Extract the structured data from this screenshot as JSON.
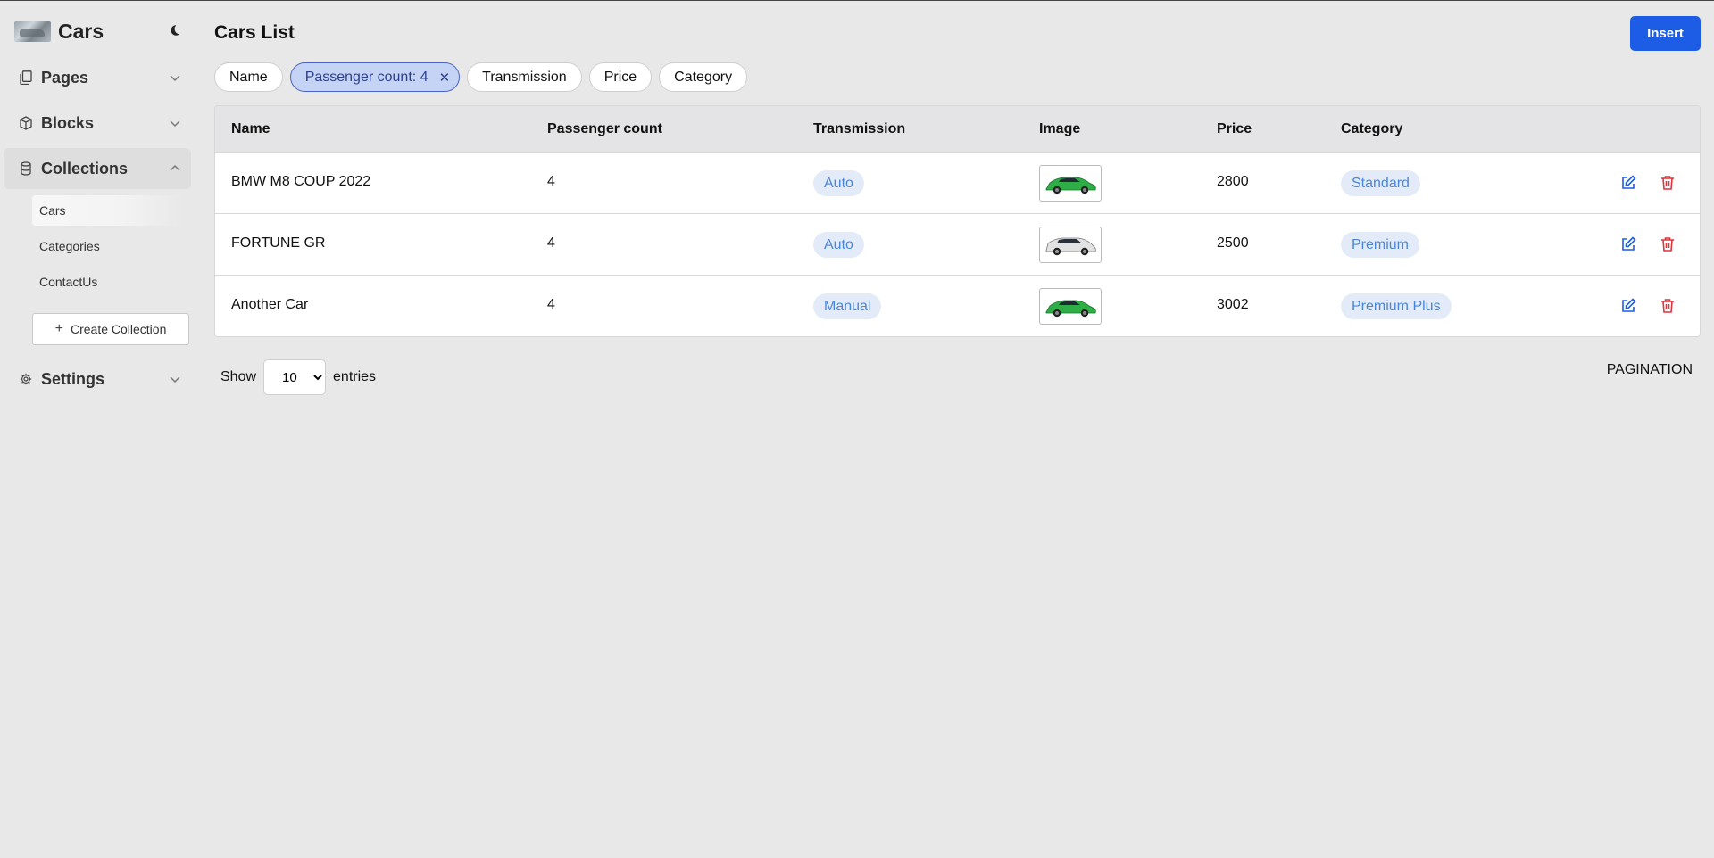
{
  "sidebar": {
    "brand_title": "Cars",
    "sections": [
      {
        "label": "Pages"
      },
      {
        "label": "Blocks"
      },
      {
        "label": "Collections"
      },
      {
        "label": "Settings"
      }
    ],
    "collection_items": [
      {
        "label": "Cars"
      },
      {
        "label": "Categories"
      },
      {
        "label": "ContactUs"
      }
    ],
    "create_collection_label": "Create Collection"
  },
  "header": {
    "title": "Cars List",
    "insert_label": "Insert"
  },
  "filters": [
    {
      "label": "Name"
    },
    {
      "label": "Passenger count: 4",
      "active": true
    },
    {
      "label": "Transmission"
    },
    {
      "label": "Price"
    },
    {
      "label": "Category"
    }
  ],
  "table": {
    "columns": [
      "Name",
      "Passenger count",
      "Transmission",
      "Image",
      "Price",
      "Category"
    ],
    "rows": [
      {
        "name": "BMW M8 COUP 2022",
        "passengers": "4",
        "transmission": "Auto",
        "image_color": "#2fae48",
        "price": "2800",
        "category": "Standard"
      },
      {
        "name": "FORTUNE GR",
        "passengers": "4",
        "transmission": "Auto",
        "image_color": "#d9d9d9",
        "price": "2500",
        "category": "Premium"
      },
      {
        "name": "Another Car",
        "passengers": "4",
        "transmission": "Manual",
        "image_color": "#2fae48",
        "price": "3002",
        "category": "Premium Plus"
      }
    ]
  },
  "footer": {
    "show_label": "Show",
    "entries_value": "10",
    "entries_label": "entries",
    "pagination_label": "PAGINATION"
  },
  "colors": {
    "accent": "#1d5de6",
    "badge_bg": "#e3ebf8",
    "badge_text": "#4a86d8",
    "delete": "#d9363e"
  }
}
